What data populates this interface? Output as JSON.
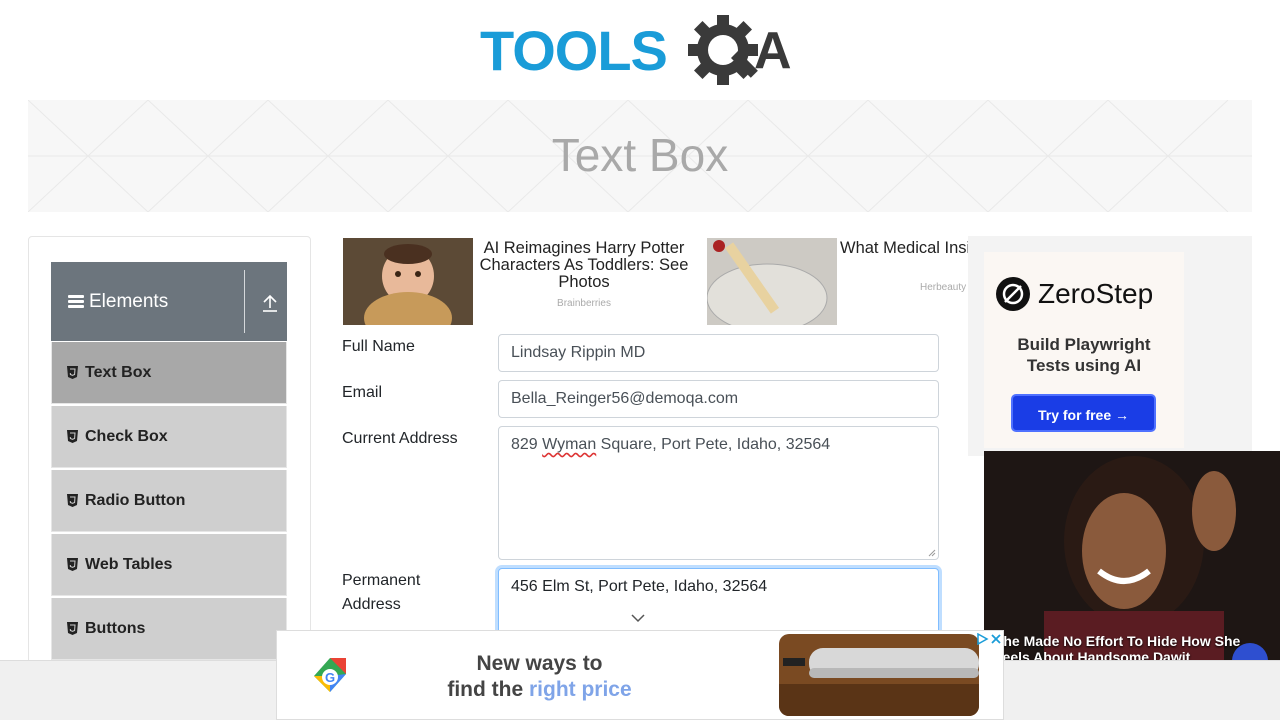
{
  "header": {
    "logo_text": "TOOLSQA"
  },
  "banner": {
    "title": "Text Box"
  },
  "sidebar": {
    "group": {
      "title": "Elements"
    },
    "items": [
      {
        "label": "Text Box",
        "active": true
      },
      {
        "label": "Check Box",
        "active": false
      },
      {
        "label": "Radio Button",
        "active": false
      },
      {
        "label": "Web Tables",
        "active": false
      },
      {
        "label": "Buttons",
        "active": false
      }
    ]
  },
  "ads_top": [
    {
      "title": "AI Reimagines Harry Potter Characters As Toddlers: See Photos",
      "source": "Brainberries"
    },
    {
      "title": "What Medical Insights From Ancient India Know",
      "source": "Herbeauty"
    }
  ],
  "form": {
    "full_name": {
      "label": "Full Name",
      "value": "Lindsay Rippin MD"
    },
    "email": {
      "label": "Email",
      "value": "Bella_Reinger56@demoqa.com"
    },
    "current_address": {
      "label": "Current Address",
      "value_prefix": "829 ",
      "value_misspelled": "Wyman",
      "value_suffix": " Square, Port Pete, Idaho, 32564"
    },
    "permanent_address": {
      "label_line1": "Permanent",
      "label_line2": "Address",
      "value": "456 Elm St, Port Pete, Idaho, 32564"
    }
  },
  "right_ad": {
    "brand": "ZeroStep",
    "tagline_line1": "Build Playwright",
    "tagline_line2": "Tests using AI",
    "cta": "Try for free →"
  },
  "video_ad": {
    "caption_line1": "She Made No Effort To Hide How She",
    "caption_line2": "Feels About Handsome Dawit"
  },
  "bottom_ad": {
    "headline_line1": "New ways to",
    "headline_line2_plain": "find the ",
    "headline_line2_highlight": "right price"
  },
  "colors": {
    "logo_blue": "#1a9cd8",
    "logo_dark": "#333333",
    "header_gray": "#6c757d",
    "cta_blue": "#1a3de6"
  }
}
